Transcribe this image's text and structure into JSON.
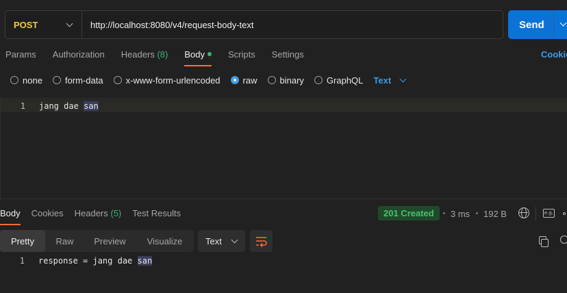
{
  "request": {
    "method": "POST",
    "url": "http://localhost:8080/v4/request-body-text",
    "send_label": "Send"
  },
  "request_tabs": [
    {
      "label": "Params"
    },
    {
      "label": "Authorization"
    },
    {
      "label": "Headers",
      "count": "(8)"
    },
    {
      "label": "Body",
      "active": true
    },
    {
      "label": "Scripts"
    },
    {
      "label": "Settings"
    }
  ],
  "cookies_label": "Cookie",
  "body_types": [
    {
      "label": "none"
    },
    {
      "label": "form-data"
    },
    {
      "label": "x-www-form-urlencoded"
    },
    {
      "label": "raw",
      "selected": true
    },
    {
      "label": "binary"
    },
    {
      "label": "GraphQL"
    }
  ],
  "raw_format": "Text",
  "editor": {
    "line_number": "1",
    "words": [
      "jang",
      "dae",
      "san"
    ]
  },
  "response_tabs": [
    {
      "label": "Body",
      "active": true
    },
    {
      "label": "Cookies"
    },
    {
      "label": "Headers",
      "count": "(5)"
    },
    {
      "label": "Test Results"
    }
  ],
  "response_meta": {
    "status": "201 Created",
    "time": "3 ms",
    "size": "192 B"
  },
  "view_tabs": [
    "Pretty",
    "Raw",
    "Preview",
    "Visualize"
  ],
  "response_format": "Text",
  "response_body": {
    "line_number": "1",
    "prefix": "response = jang dae ",
    "highlighted": "san"
  },
  "colors": {
    "accent_blue": "#0b73d8",
    "method_yellow": "#f2c94c",
    "status_green": "#49c06b",
    "active_tab_underline": "#ff6c37"
  }
}
